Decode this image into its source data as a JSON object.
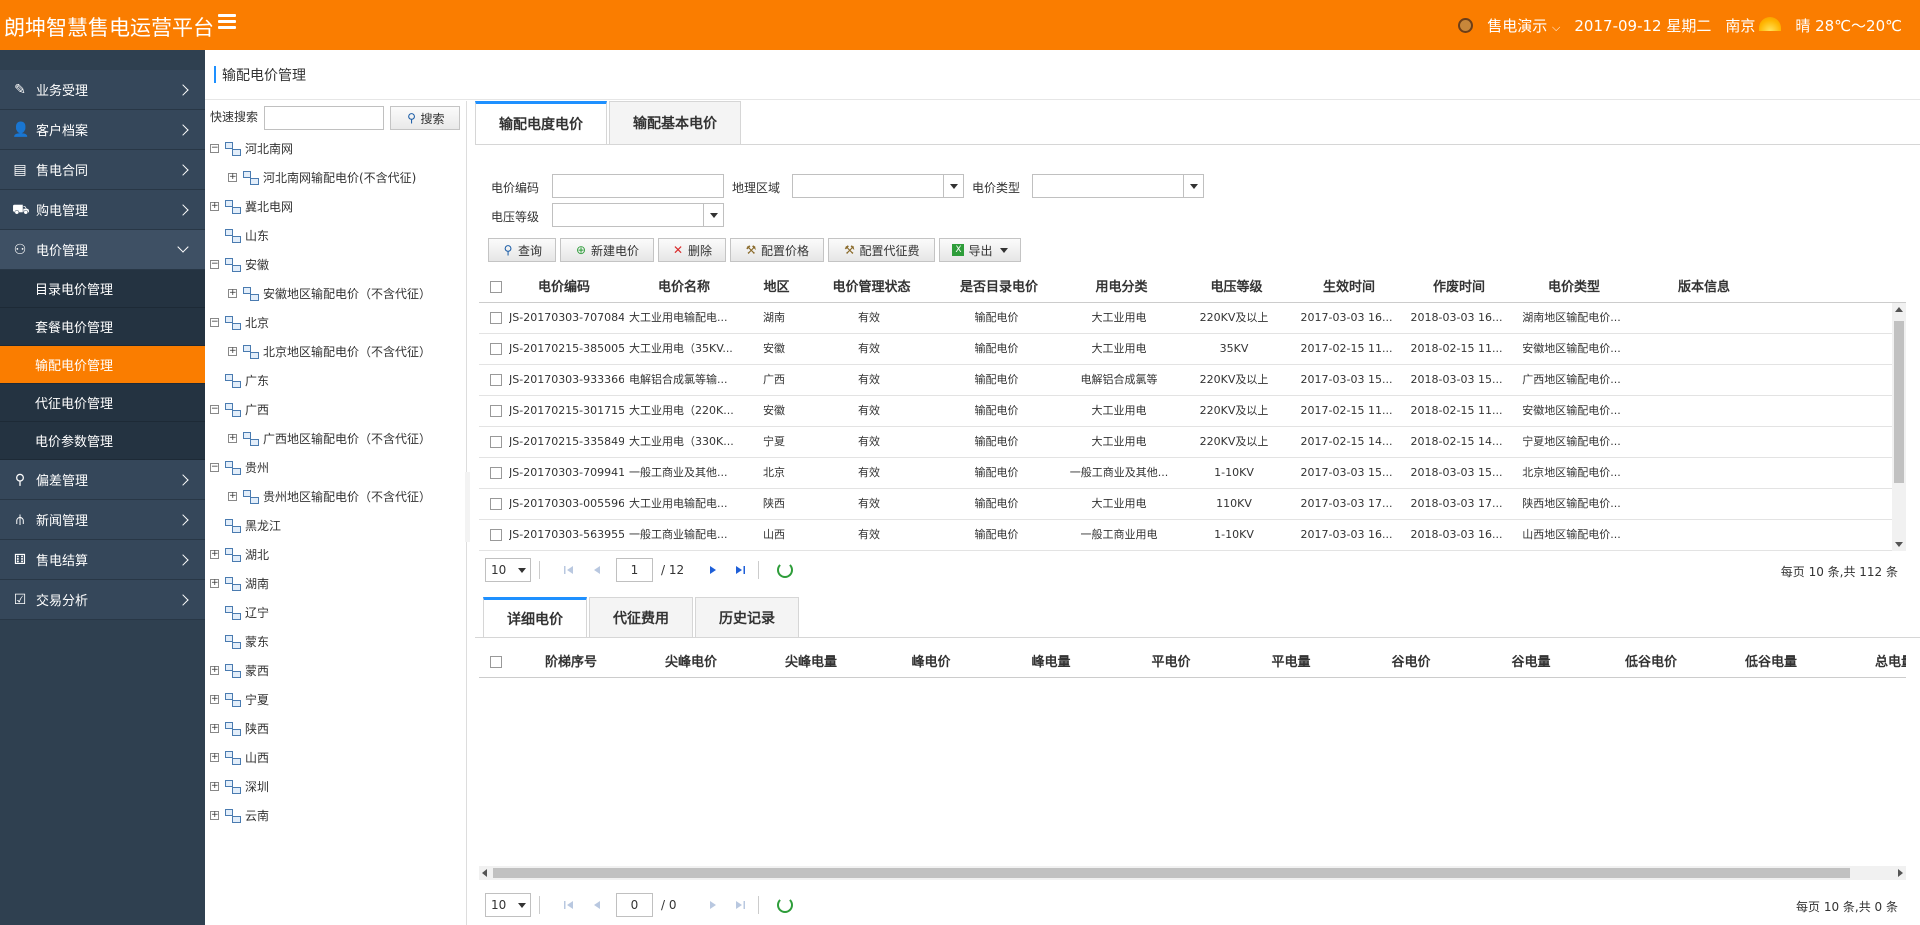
{
  "header": {
    "title": "朗坤智慧售电运营平台",
    "user": "售电演示",
    "date": "2017-09-12 星期二",
    "city": "南京",
    "weather": "晴 28℃～20℃"
  },
  "sidebar": {
    "items": [
      {
        "label": "业务受理"
      },
      {
        "label": "客户档案"
      },
      {
        "label": "售电合同"
      },
      {
        "label": "购电管理"
      },
      {
        "label": "电价管理"
      },
      {
        "label": "偏差管理"
      },
      {
        "label": "新闻管理"
      },
      {
        "label": "售电结算"
      },
      {
        "label": "交易分析"
      }
    ],
    "subitems": [
      {
        "label": "目录电价管理"
      },
      {
        "label": "套餐电价管理"
      },
      {
        "label": "输配电价管理"
      },
      {
        "label": "代征电价管理"
      },
      {
        "label": "电价参数管理"
      }
    ]
  },
  "breadcrumb": {
    "title": "输配电价管理"
  },
  "tree": {
    "search_label": "快速搜索",
    "search_button": "搜索",
    "nodes": [
      {
        "label": "河北南网",
        "level": 0,
        "exp": "−"
      },
      {
        "label": "河北南网输配电价(不含代征)",
        "level": 1,
        "exp": "+"
      },
      {
        "label": "冀北电网",
        "level": 0,
        "exp": "+"
      },
      {
        "label": "山东",
        "level": 0,
        "exp": ""
      },
      {
        "label": "安徽",
        "level": 0,
        "exp": "−"
      },
      {
        "label": "安徽地区输配电价（不含代征）",
        "level": 1,
        "exp": "+"
      },
      {
        "label": "北京",
        "level": 0,
        "exp": "−"
      },
      {
        "label": "北京地区输配电价（不含代征）",
        "level": 1,
        "exp": "+"
      },
      {
        "label": "广东",
        "level": 0,
        "exp": ""
      },
      {
        "label": "广西",
        "level": 0,
        "exp": "−"
      },
      {
        "label": "广西地区输配电价（不含代征）",
        "level": 1,
        "exp": "+"
      },
      {
        "label": "贵州",
        "level": 0,
        "exp": "−"
      },
      {
        "label": "贵州地区输配电价（不含代征）",
        "level": 1,
        "exp": "+"
      },
      {
        "label": "黑龙江",
        "level": 0,
        "exp": ""
      },
      {
        "label": "湖北",
        "level": 0,
        "exp": "+"
      },
      {
        "label": "湖南",
        "level": 0,
        "exp": "+"
      },
      {
        "label": "辽宁",
        "level": 0,
        "exp": ""
      },
      {
        "label": "蒙东",
        "level": 0,
        "exp": ""
      },
      {
        "label": "蒙西",
        "level": 0,
        "exp": "+"
      },
      {
        "label": "宁夏",
        "level": 0,
        "exp": "+"
      },
      {
        "label": "陕西",
        "level": 0,
        "exp": "+"
      },
      {
        "label": "山西",
        "level": 0,
        "exp": "+"
      },
      {
        "label": "深圳",
        "level": 0,
        "exp": "+"
      },
      {
        "label": "云南",
        "level": 0,
        "exp": "+"
      }
    ]
  },
  "tabs": [
    {
      "label": "输配电度电价"
    },
    {
      "label": "输配基本电价"
    }
  ],
  "filters": {
    "code_label": "电价编码",
    "region_label": "地理区域",
    "type_label": "电价类型",
    "voltage_label": "电压等级"
  },
  "toolbar": {
    "query": "查询",
    "new": "新建电价",
    "delete": "删除",
    "config_price": "配置价格",
    "config_fee": "配置代征费",
    "export": "导出"
  },
  "grid": {
    "columns": [
      "电价编码",
      "电价名称",
      "地区",
      "电价管理状态",
      "是否目录电价",
      "用电分类",
      "电压等级",
      "生效时间",
      "作废时间",
      "电价类型",
      "版本信息"
    ],
    "rows": [
      [
        "JS-20170303-707084",
        "大工业用电输配电...",
        "湖南",
        "有效",
        "输配电价",
        "大工业用电",
        "220KV及以上",
        "2017-03-03 16...",
        "2018-03-03 16...",
        "湖南地区输配电价...",
        ""
      ],
      [
        "JS-20170215-385005",
        "大工业用电（35KV...",
        "安徽",
        "有效",
        "输配电价",
        "大工业用电",
        "35KV",
        "2017-02-15 11...",
        "2018-02-15 11...",
        "安徽地区输配电价...",
        ""
      ],
      [
        "JS-20170303-933366",
        "电解铝合成氯等输...",
        "广西",
        "有效",
        "输配电价",
        "电解铝合成氯等",
        "220KV及以上",
        "2017-03-03 15...",
        "2018-03-03 15...",
        "广西地区输配电价...",
        ""
      ],
      [
        "JS-20170215-301715",
        "大工业用电（220K...",
        "安徽",
        "有效",
        "输配电价",
        "大工业用电",
        "220KV及以上",
        "2017-02-15 11...",
        "2018-02-15 11...",
        "安徽地区输配电价...",
        ""
      ],
      [
        "JS-20170215-335849",
        "大工业用电（330K...",
        "宁夏",
        "有效",
        "输配电价",
        "大工业用电",
        "220KV及以上",
        "2017-02-15 14...",
        "2018-02-15 14...",
        "宁夏地区输配电价...",
        ""
      ],
      [
        "JS-20170303-709941",
        "一般工商业及其他...",
        "北京",
        "有效",
        "输配电价",
        "一般工商业及其他...",
        "1-10KV",
        "2017-03-03 15...",
        "2018-03-03 15...",
        "北京地区输配电价...",
        ""
      ],
      [
        "JS-20170303-005596",
        "大工业用电输配电...",
        "陕西",
        "有效",
        "输配电价",
        "大工业用电",
        "110KV",
        "2017-03-03 17...",
        "2018-03-03 17...",
        "陕西地区输配电价...",
        ""
      ],
      [
        "JS-20170303-563955",
        "一般工商业输配电...",
        "山西",
        "有效",
        "输配电价",
        "一般工商业用电",
        "1-10KV",
        "2017-03-03 16...",
        "2018-03-03 16...",
        "山西地区输配电价...",
        ""
      ]
    ]
  },
  "pager": {
    "size": "10",
    "page": "1",
    "total_pages": "/ 12",
    "info": "每页 10 条,共 112 条"
  },
  "subtabs": [
    {
      "label": "详细电价"
    },
    {
      "label": "代征费用"
    },
    {
      "label": "历史记录"
    }
  ],
  "detail": {
    "columns": [
      "阶梯序号",
      "尖峰电价",
      "尖峰电量",
      "峰电价",
      "峰电量",
      "平电价",
      "平电量",
      "谷电价",
      "谷电量",
      "低谷电价",
      "低谷电量",
      "总电量"
    ]
  },
  "pager2": {
    "size": "10",
    "page": "0",
    "total_pages": "/ 0",
    "info": "每页 10 条,共 0 条"
  }
}
